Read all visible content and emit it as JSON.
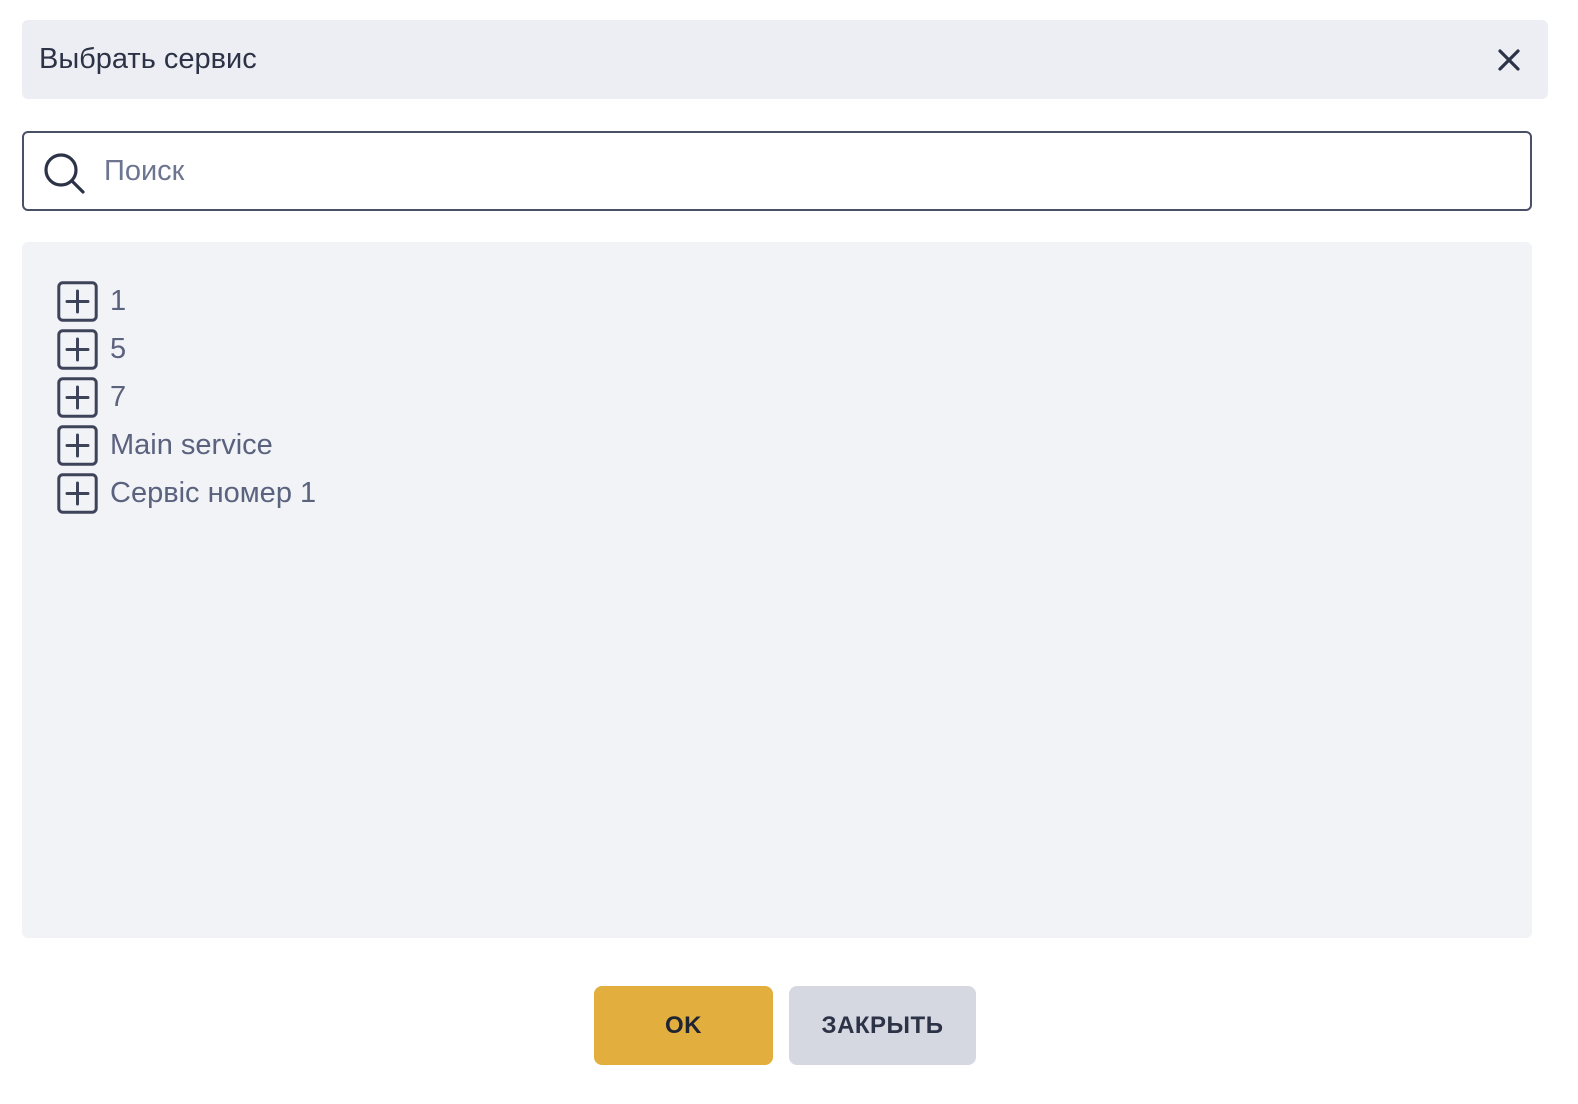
{
  "dialog": {
    "title": "Выбрать сервис",
    "close_icon": "close-icon"
  },
  "search": {
    "placeholder": "Поиск",
    "value": "",
    "icon": "search-icon"
  },
  "tree": {
    "expand_icon": "plus-square-icon",
    "items": [
      {
        "label": "1"
      },
      {
        "label": "5"
      },
      {
        "label": "7"
      },
      {
        "label": "Main service"
      },
      {
        "label": "Сервіс номер 1"
      }
    ]
  },
  "footer": {
    "ok_label": "OK",
    "close_label": "ЗАКРЫТЬ"
  },
  "colors": {
    "accent": "#e2ae3d",
    "secondary_button": "#d5d7e1",
    "header_bg": "#edeef3",
    "tree_bg": "#f2f3f7",
    "text": "#2c3346"
  }
}
